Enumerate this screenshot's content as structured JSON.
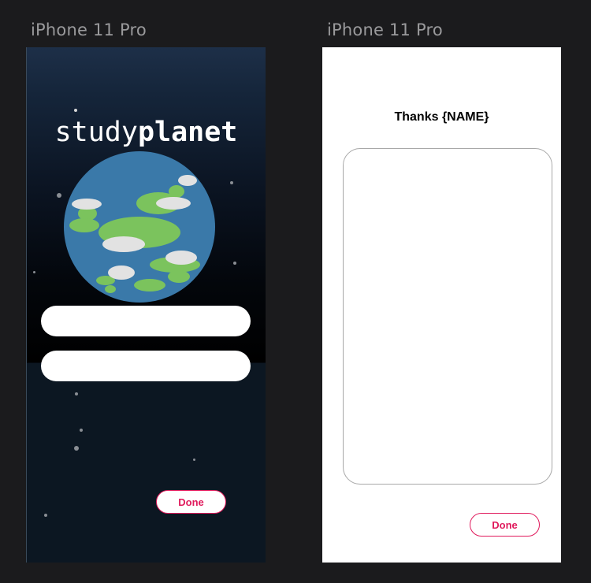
{
  "frames": [
    {
      "label": "iPhone 11 Pro",
      "logo": {
        "light": "study",
        "bold": "planet"
      },
      "fields": [
        {
          "value": "",
          "placeholder": ""
        },
        {
          "value": "",
          "placeholder": ""
        }
      ],
      "done_label": "Done"
    },
    {
      "label": "iPhone 11 Pro",
      "heading": "Thanks {NAME}",
      "textarea": {
        "value": "",
        "placeholder": ""
      },
      "done_label": "Done"
    }
  ],
  "colors": {
    "canvas_bg": "#1b1b1d",
    "accent": "#e01a5c",
    "planet_ocean": "#3a79a9",
    "planet_land": "#7bc35d",
    "cloud": "#e2e2e2"
  }
}
